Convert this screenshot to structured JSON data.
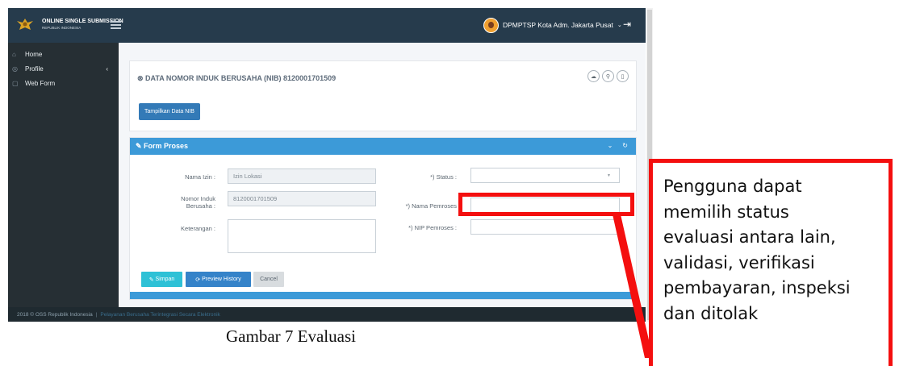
{
  "header": {
    "brand_title": "ONLINE SINGLE SUBMISSION",
    "brand_subtitle": "REPUBLIK INDONESIA",
    "user_name": "DPMPTSP Kota Adm. Jakarta Pusat",
    "colors": {
      "topbar": "#263b4c",
      "sidebar": "#262f34",
      "accent": "#3c9ad8"
    }
  },
  "sidebar": {
    "items": [
      {
        "label": "Home",
        "icon": "home-icon"
      },
      {
        "label": "Profile",
        "icon": "profile-icon"
      },
      {
        "label": "Web Form",
        "icon": "document-icon"
      }
    ]
  },
  "nib_card": {
    "title": "DATA NOMOR INDUK BERUSAHA (NIB) 8120001701509",
    "button_label": "Tampilkan Data NIB",
    "action_icons": [
      "cloud-download-icon",
      "link-icon",
      "trash-icon"
    ]
  },
  "form": {
    "panel_title": "Form Proses",
    "nama_izin_label": "Nama Izin :",
    "nama_izin_value": "Izin Lokasi",
    "nomor_induk_label_1": "Nomor Induk",
    "nomor_induk_label_2": "Berusaha :",
    "nomor_induk_value": "8120001701509",
    "keterangan_label": "Keterangan :",
    "status_label": "*) Status :",
    "nama_pemroses_label": "*) Nama Pemroses",
    "nip_pemroses_label": "*) NIP Pemroses :",
    "simpan_label": "Simpan",
    "preview_label": "Preview History",
    "cancel_label": "Cancel"
  },
  "footer": {
    "copyright": "2018 © OSS Republik Indonesia",
    "separator": "|",
    "tagline": "Pelayanan Berusaha Terintegrasi Secara Elektronik"
  },
  "caption": "Gambar 7 Evaluasi",
  "callout": {
    "lines": [
      "Pengguna dapat",
      "memilih status",
      "evaluasi antara lain,",
      "validasi, verifikasi",
      "pembayaran, inspeksi",
      "dan ditolak"
    ],
    "color": "#f40f0f"
  }
}
